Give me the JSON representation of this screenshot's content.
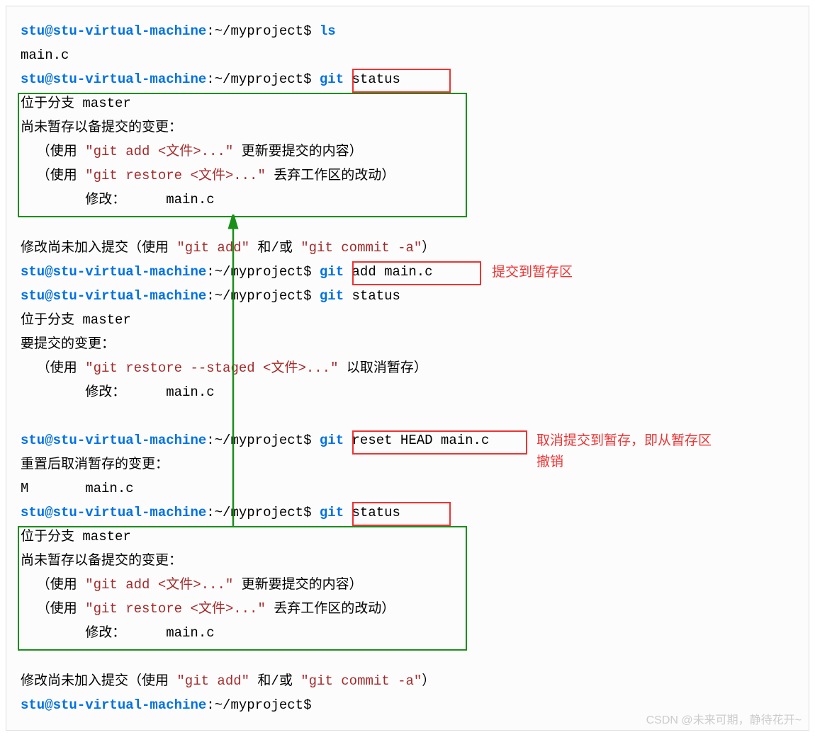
{
  "prompt_base": "stu@stu-virtual-machine",
  "prompt_path": ":~/myproject",
  "dollar": "$ ",
  "cmd_ls": "ls",
  "out_ls": "main.c",
  "cmd_git": "git",
  "cmd_status": " status",
  "cmd_add_main": " add main.c",
  "cmd_reset_head": " reset HEAD main.c",
  "status": {
    "branch": "位于分支 master",
    "unstaged_header": "尚未暂存以备提交的变更：",
    "hint_add": "  （使用 \"git add <文件>...\" 更新要提交的内容）",
    "hint_add_pre": "  （使用 ",
    "hint_add_cmd": "\"git add <文件>...\"",
    "hint_add_suf": " 更新要提交的内容）",
    "hint_restore_pre": "  （使用 ",
    "hint_restore_cmd": "\"git restore <文件>...\"",
    "hint_restore_suf": " 丢弃工作区的改动）",
    "hint_restore_staged_pre": "  （使用 ",
    "hint_restore_staged_cmd": "\"git restore --staged <文件>...\"",
    "hint_restore_staged_suf": " 以取消暂存）",
    "modified": "        修改：     main.c",
    "to_commit_header": "要提交的变更：",
    "not_added_pre": "修改尚未加入提交（使用 ",
    "not_added_mid1": "\"git add\"",
    "not_added_mid2": " 和/或 ",
    "not_added_mid3": "\"git commit -a\"",
    "not_added_suf": "）",
    "reset_unstage": "重置后取消暂存的变更：",
    "reset_file": "M       main.c"
  },
  "annotations": {
    "add_stage": "提交到暂存区",
    "cancel_stage_l1": "取消提交到暂存，即从暂存区",
    "cancel_stage_l2": "撤销"
  },
  "watermark": "CSDN @未来可期，静待花开~"
}
